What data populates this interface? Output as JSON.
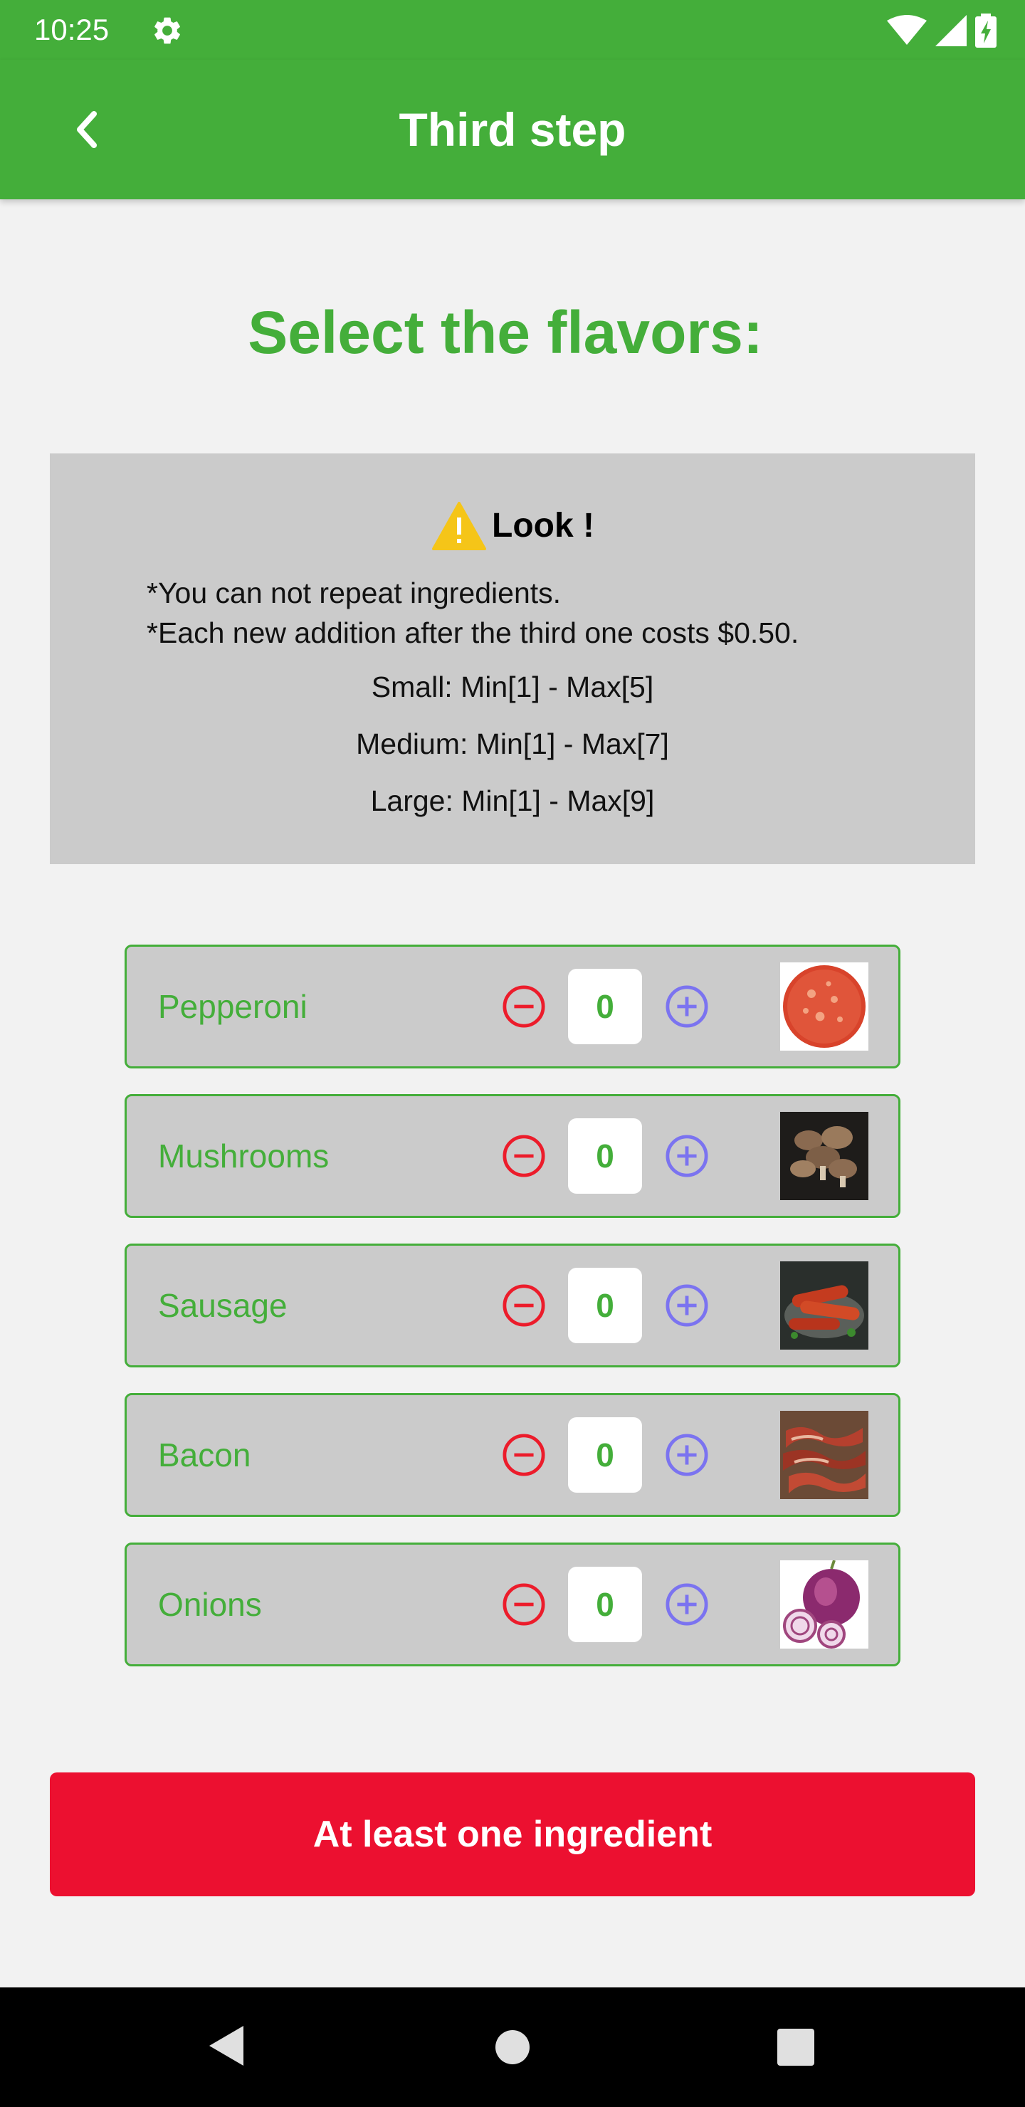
{
  "status_bar": {
    "time": "10:25",
    "icons": [
      "gear-icon",
      "wifi-icon",
      "cell-signal-icon",
      "battery-charging-icon"
    ]
  },
  "app_bar": {
    "back_icon": "chevron-left-icon",
    "title": "Third step"
  },
  "heading": "Select the flavors:",
  "notice": {
    "icon": "warning-icon",
    "title": "Look !",
    "rules": [
      "*You can not repeat ingredients.",
      "*Each new addition after the third one costs $0.50."
    ],
    "sizes": [
      "Small: Min[1] - Max[5]",
      "Medium: Min[1] - Max[7]",
      "Large: Min[1] - Max[9]"
    ]
  },
  "ingredients": [
    {
      "name": "Pepperoni",
      "quantity": "0"
    },
    {
      "name": "Mushrooms",
      "quantity": "0"
    },
    {
      "name": "Sausage",
      "quantity": "0"
    },
    {
      "name": "Bacon",
      "quantity": "0"
    },
    {
      "name": "Onions",
      "quantity": "0"
    }
  ],
  "action_button": {
    "label": "At least one ingredient"
  },
  "colors": {
    "primary_green": "#44ae3a",
    "minus_red": "#ec1c2b",
    "plus_blue": "#7b73f0",
    "action_red": "#ec1030",
    "panel_gray": "#cbcbcb",
    "warning_yellow": "#f5c518"
  },
  "nav_bar": {
    "icons": [
      "nav-back-icon",
      "nav-home-icon",
      "nav-recents-icon"
    ]
  }
}
